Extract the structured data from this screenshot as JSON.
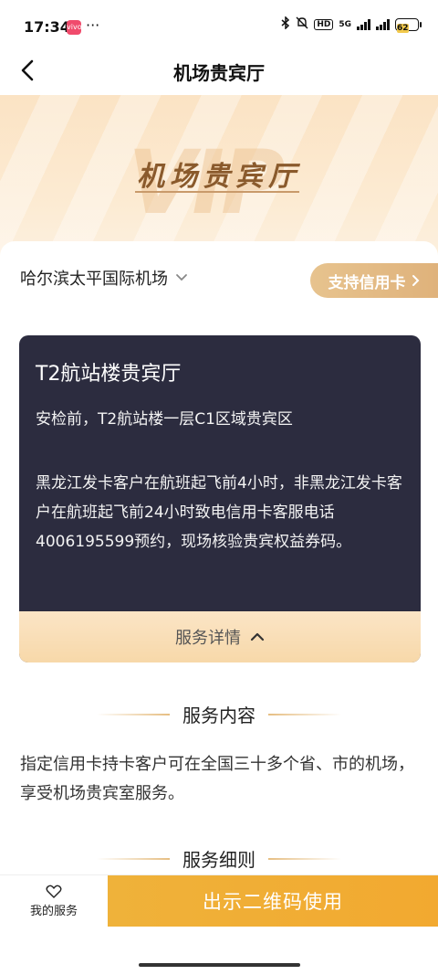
{
  "status_bar": {
    "time": "17:34",
    "app_badge": "vivo",
    "more": "···",
    "hd": "HD",
    "network": "5G",
    "battery": "62"
  },
  "nav": {
    "title": "机场贵宾厅"
  },
  "banner": {
    "watermark": "VIP",
    "title": "机场贵宾厅"
  },
  "airport": {
    "selected": "哈尔滨太平国际机场",
    "support_button": "支持信用卡"
  },
  "lounge": {
    "name": "T2航站楼贵宾厅",
    "location": "安检前，T2航站楼一层C1区域贵宾区",
    "description": "黑龙江发卡客户在航班起飞前4小时，非黑龙江发卡客户在航班起飞前24小时致电信用卡客服电话4006195599预约，现场核验贵宾权益券码。",
    "details_toggle": "服务详情"
  },
  "service_content": {
    "heading": "服务内容",
    "text": "指定信用卡持卡客户可在全国三十多个省、市的机场，享受机场贵宾室服务。"
  },
  "service_rules": {
    "heading": "服务细则"
  },
  "bottom_bar": {
    "my_service": "我的服务",
    "use_button": "出示二维码使用"
  },
  "colors": {
    "accent_gold": "#dfb27b",
    "cta_orange": "#f2a930",
    "card_dark": "#2c2c3f"
  }
}
